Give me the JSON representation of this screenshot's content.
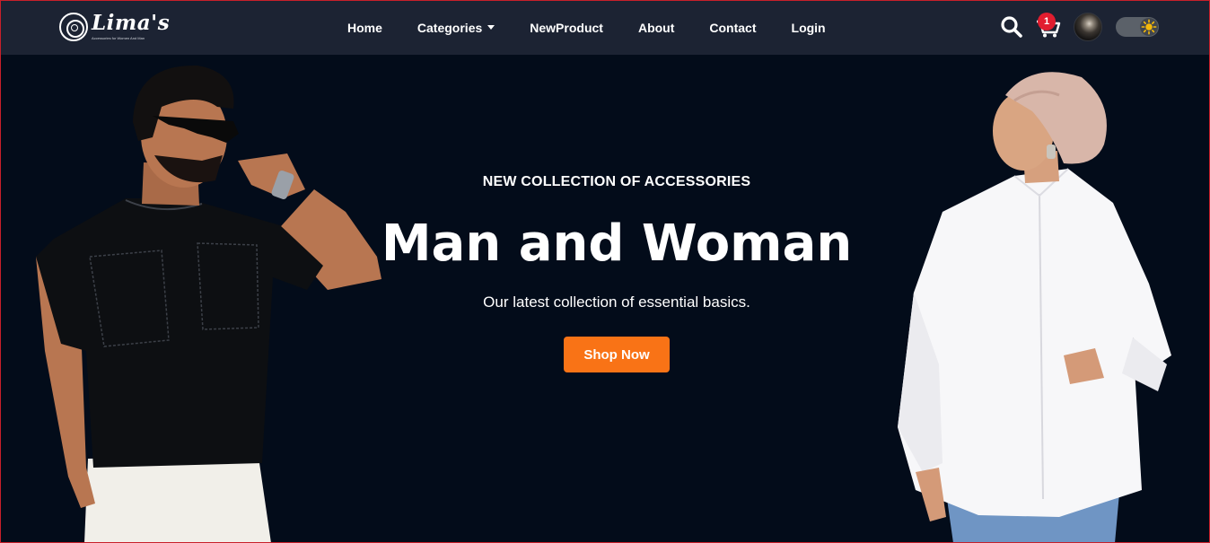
{
  "brand": {
    "name": "Lima's",
    "tagline": "Accessories for Women And Man"
  },
  "nav": {
    "links": [
      {
        "label": "Home"
      },
      {
        "label": "Categories",
        "has_dropdown": true
      },
      {
        "label": "NewProduct"
      },
      {
        "label": "About"
      },
      {
        "label": "Contact"
      },
      {
        "label": "Login"
      }
    ]
  },
  "header_actions": {
    "search_icon": "search-icon",
    "cart_icon": "cart-icon",
    "cart_count": "1",
    "avatar": "user-avatar",
    "theme_toggle_icon": "sun-icon"
  },
  "hero": {
    "eyebrow": "NEW COLLECTION OF ACCESSORIES",
    "title": "Man and Woman",
    "subtitle": "Our latest collection of essential basics.",
    "cta_label": "Shop Now"
  },
  "colors": {
    "navbar_bg": "#1c2333",
    "hero_bg": "#030c1a",
    "cta": "#f97316",
    "badge": "#e11d2f",
    "sun": "#f5b90a"
  }
}
